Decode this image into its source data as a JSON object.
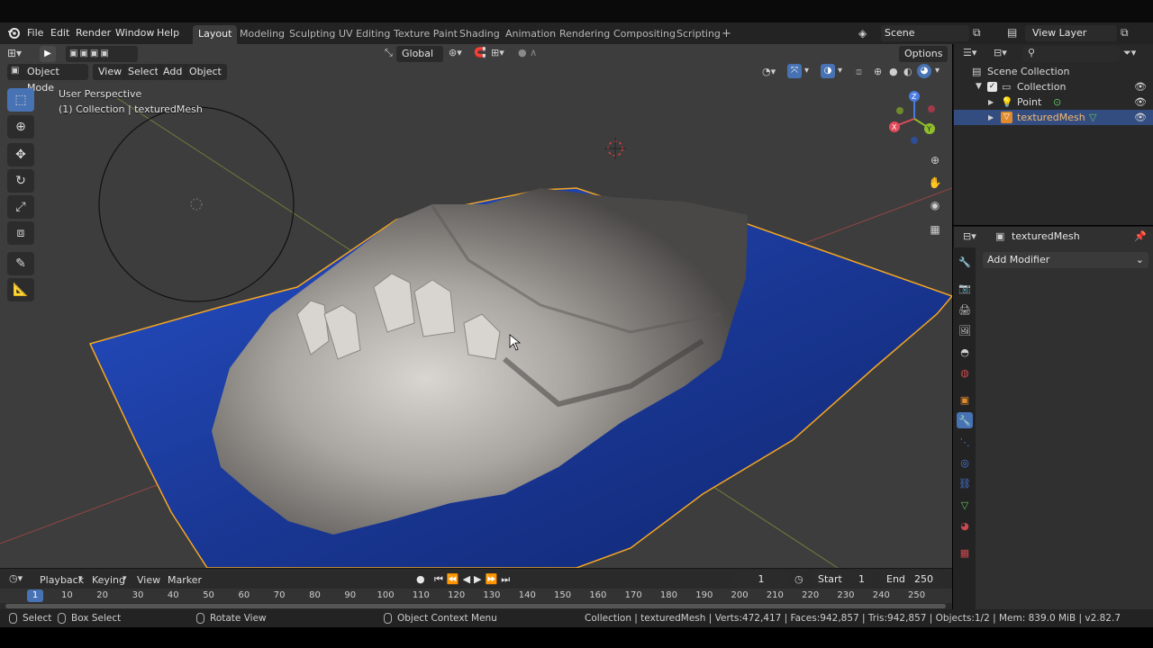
{
  "topbar": {
    "menus": [
      "File",
      "Edit",
      "Render",
      "Window",
      "Help"
    ],
    "workspaces": [
      "Layout",
      "Modeling",
      "Sculpting",
      "UV Editing",
      "Texture Paint",
      "Shading",
      "Animation",
      "Rendering",
      "Compositing",
      "Scripting"
    ],
    "active_workspace": "Layout",
    "add_workspace": "+",
    "scene": "Scene",
    "view_layer": "View Layer"
  },
  "viewport_header": {
    "mode": "Object Mode",
    "menus": [
      "View",
      "Select",
      "Add",
      "Object"
    ],
    "transform_orientation": "Global",
    "options": "Options"
  },
  "viewport": {
    "perspective": "User Perspective",
    "collection_info": "(1) Collection | texturedMesh",
    "gizmo_axes": [
      "Z",
      "Y",
      "X"
    ]
  },
  "toolbar": {
    "tools": [
      "select-box-icon",
      "cursor-icon",
      "move-icon",
      "rotate-icon",
      "scale-icon",
      "transform-icon",
      "annotate-icon",
      "measure-icon"
    ],
    "active": "select-box-icon"
  },
  "outliner": {
    "root": "Scene Collection",
    "collection": "Collection",
    "items": [
      "Point",
      "texturedMesh"
    ],
    "selected": "texturedMesh"
  },
  "properties": {
    "object_name": "texturedMesh",
    "add_modifier": "Add Modifier",
    "active_tab": "modifier-tab-icon",
    "tab_colors": {
      "active": "#4772b3",
      "object": "#e08a2c",
      "data": "#5fc35f",
      "material": "#c9494f"
    }
  },
  "timeline": {
    "menus": [
      "Playback",
      "Keying",
      "View",
      "Marker"
    ],
    "current_frame": "1",
    "start_label": "Start",
    "start_value": "1",
    "end_label": "End",
    "end_value": "250",
    "ruler": [
      "1",
      "10",
      "20",
      "30",
      "40",
      "50",
      "60",
      "70",
      "80",
      "90",
      "100",
      "110",
      "120",
      "130",
      "140",
      "150",
      "160",
      "170",
      "180",
      "190",
      "200",
      "210",
      "220",
      "230",
      "240",
      "250"
    ]
  },
  "statusbar": {
    "select": "Select",
    "box_select": "Box Select",
    "rotate_view": "Rotate View",
    "context_menu": "Object Context Menu",
    "stats": "Collection | texturedMesh | Verts:472,417 | Faces:942,857 | Tris:942,857 | Objects:1/2 | Mem: 839.0 MiB | v2.82.7"
  },
  "colors": {
    "accent": "#4772b3",
    "selection_outline": "#f5a623",
    "ground_plane": "#1f3f9c",
    "viewport_bg": "#3d3d3d"
  }
}
